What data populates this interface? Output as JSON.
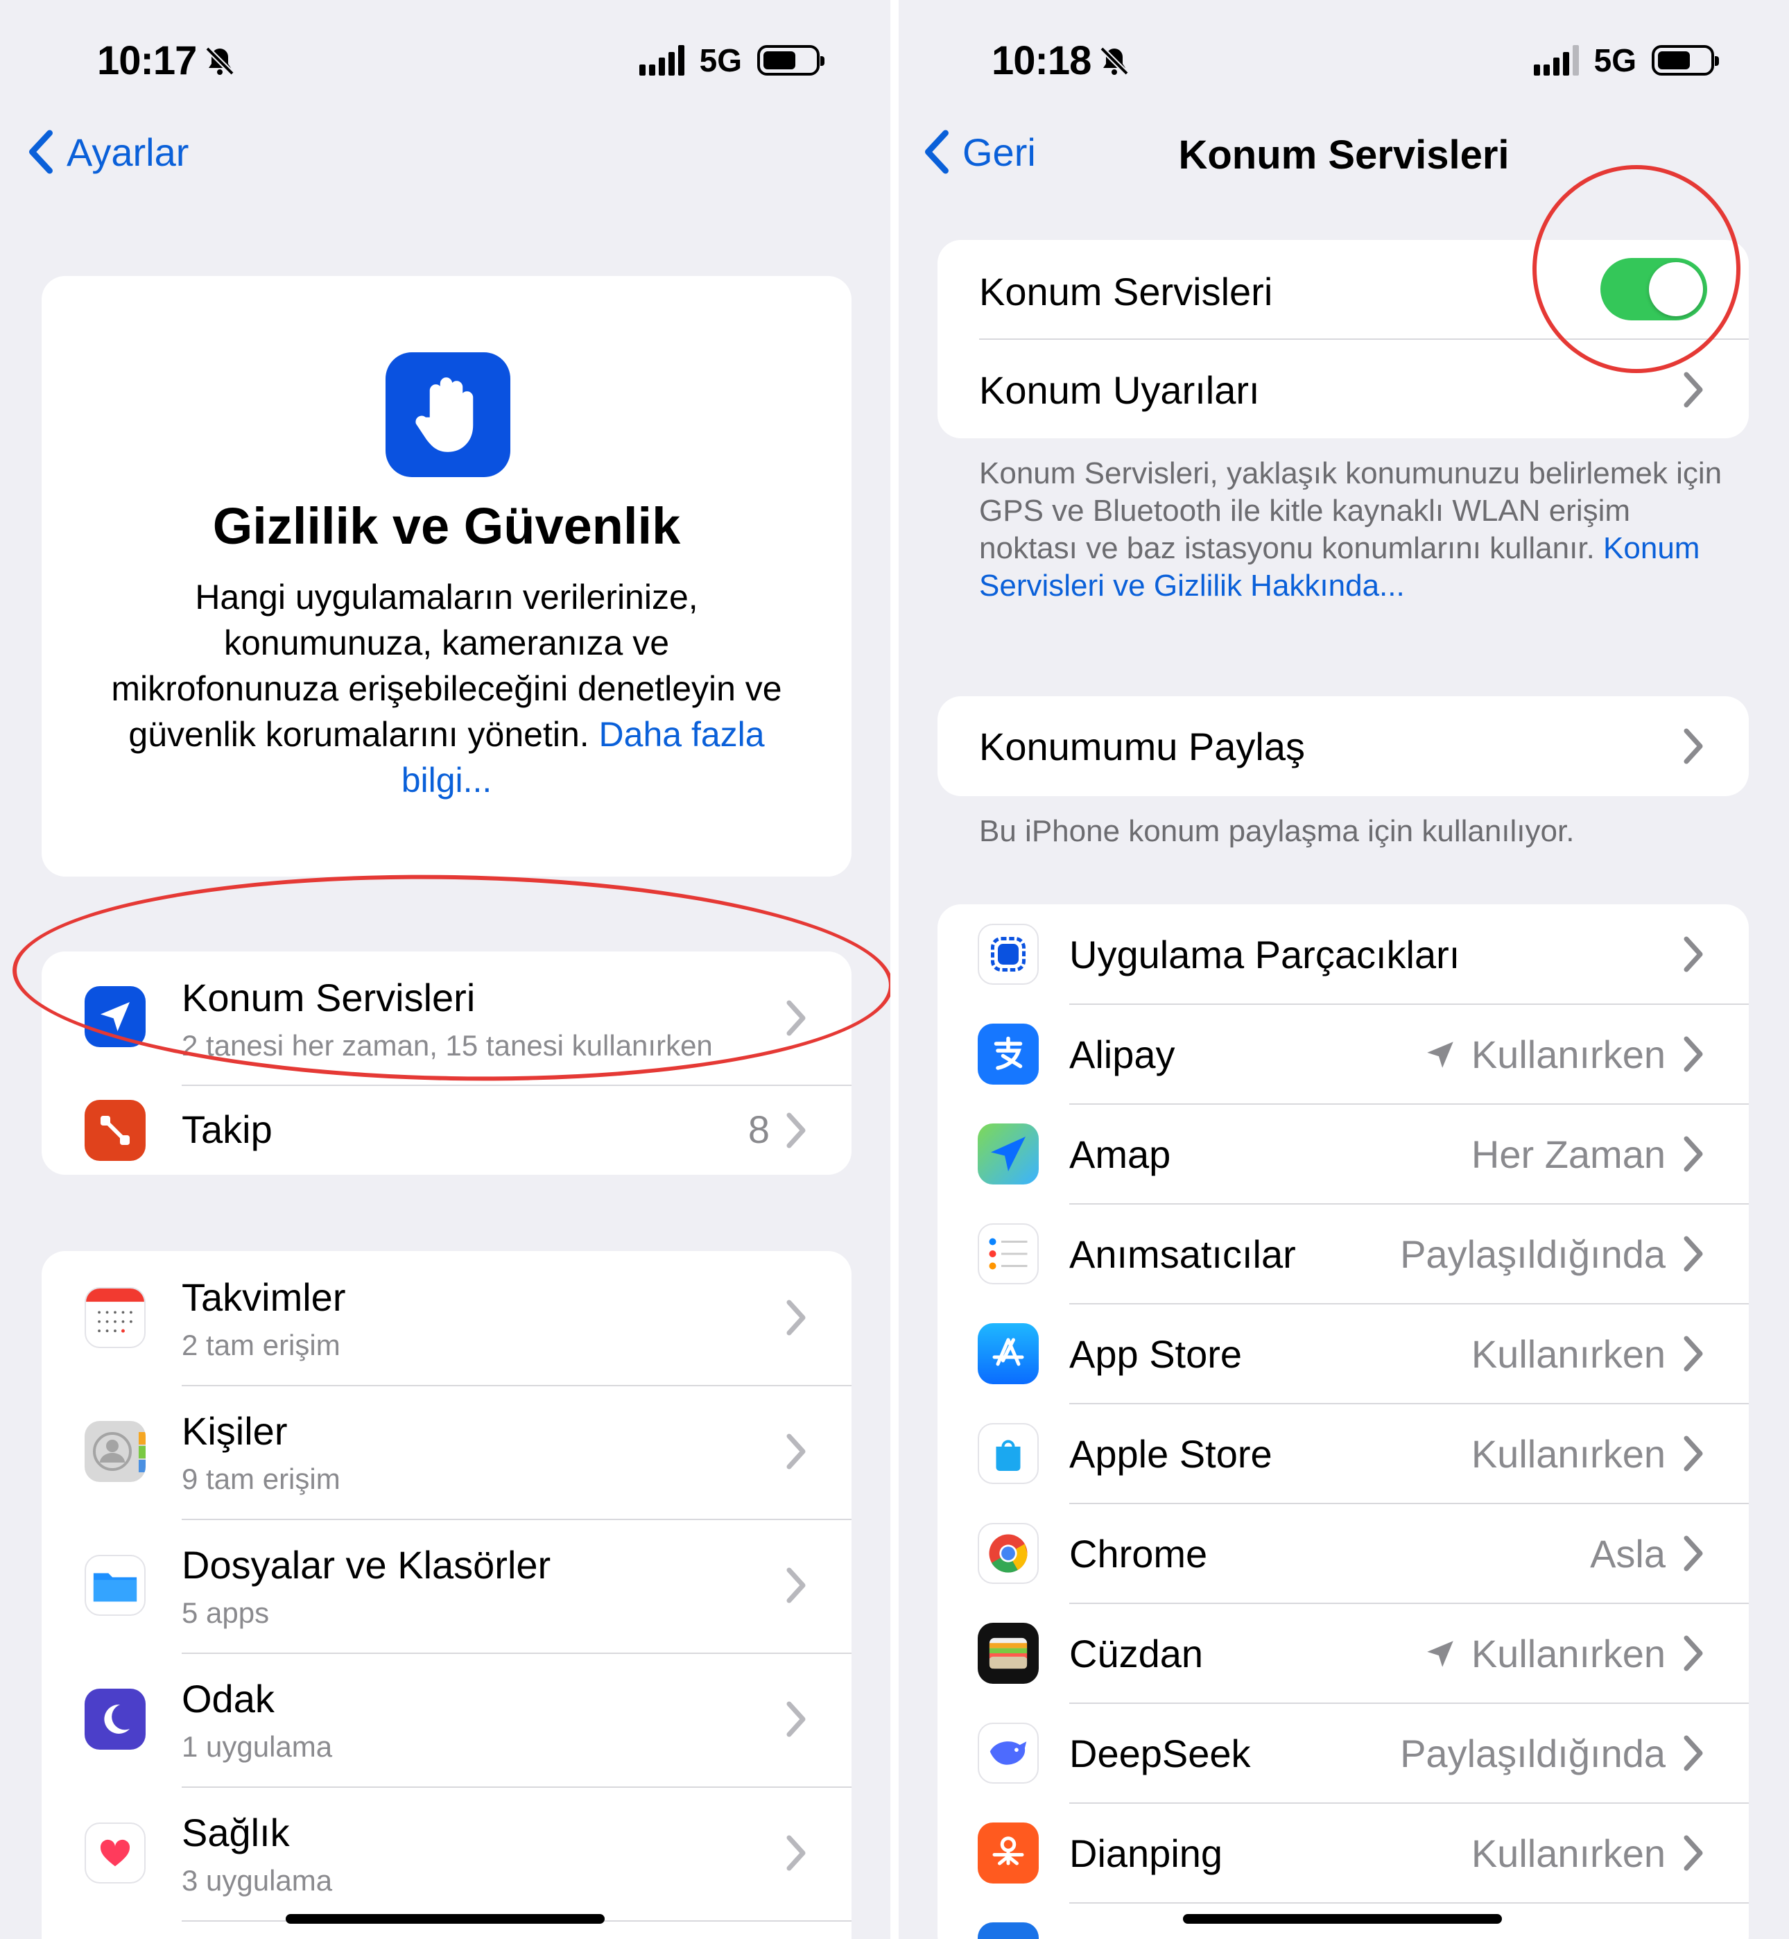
{
  "left": {
    "status": {
      "time": "10:17",
      "network": "5G"
    },
    "nav": {
      "back_label": "Ayarlar"
    },
    "hero": {
      "title": "Gizlilik ve Güvenlik",
      "description": "Hangi uygulamaların verilerinize, konumunuza, kameranıza ve mikrofonunuza erişebileceğini denetleyin ve güvenlik korumalarını yönetin.",
      "link": "Daha fazla bilgi..."
    },
    "group1": [
      {
        "title": "Konum Servisleri",
        "subtitle": "2 tanesi her zaman, 15 tanesi kullanırken",
        "icon": "location-arrow-icon"
      },
      {
        "title": "Takip",
        "value": "8",
        "icon": "tracking-icon"
      }
    ],
    "group2": [
      {
        "title": "Takvimler",
        "subtitle": "2 tam erişim",
        "icon": "calendar-icon"
      },
      {
        "title": "Kişiler",
        "subtitle": "9 tam erişim",
        "icon": "contacts-icon"
      },
      {
        "title": "Dosyalar ve Klasörler",
        "subtitle": "5 apps",
        "icon": "folder-icon"
      },
      {
        "title": "Odak",
        "subtitle": "1 uygulama",
        "icon": "moon-icon"
      },
      {
        "title": "Sağlık",
        "subtitle": "3 uygulama",
        "icon": "heart-icon"
      }
    ]
  },
  "right": {
    "status": {
      "time": "10:18",
      "network": "5G"
    },
    "nav": {
      "back_label": "Geri",
      "title": "Konum Servisleri"
    },
    "main_group": {
      "toggle_label": "Konum Servisleri",
      "toggle_on": true,
      "alerts_label": "Konum Uyarıları"
    },
    "description": "Konum Servisleri, yaklaşık konumunuzu belirlemek için GPS ve Bluetooth ile kitle kaynaklı WLAN erişim noktası ve baz istasyonu konumlarını kullanır.",
    "description_link": "Konum Servisleri ve Gizlilik Hakkında...",
    "share": {
      "label": "Konumumu Paylaş",
      "footnote": "Bu iPhone konum paylaşma için kullanılıyor."
    },
    "apps": [
      {
        "name": "Uygulama Parçacıkları",
        "value": "",
        "icon": "app-clips-icon"
      },
      {
        "name": "Alipay",
        "value": "Kullanırken",
        "recent": true,
        "icon": "alipay-icon"
      },
      {
        "name": "Amap",
        "value": "Her Zaman",
        "icon": "amap-icon"
      },
      {
        "name": "Anımsatıcılar",
        "value": "Paylaşıldığında",
        "icon": "reminders-icon"
      },
      {
        "name": "App Store",
        "value": "Kullanırken",
        "icon": "app-store-icon"
      },
      {
        "name": "Apple Store",
        "value": "Kullanırken",
        "icon": "apple-store-icon"
      },
      {
        "name": "Chrome",
        "value": "Asla",
        "icon": "chrome-icon"
      },
      {
        "name": "Cüzdan",
        "value": "Kullanırken",
        "recent": true,
        "icon": "wallet-icon"
      },
      {
        "name": "DeepSeek",
        "value": "Paylaşıldığında",
        "icon": "deepseek-icon"
      },
      {
        "name": "Dianping",
        "value": "Kullanırken",
        "icon": "dianping-icon"
      }
    ]
  },
  "colors": {
    "accent": "#0a60d9",
    "toggle_on": "#34c759",
    "annotation": "#e53935",
    "background": "#efeff4"
  }
}
